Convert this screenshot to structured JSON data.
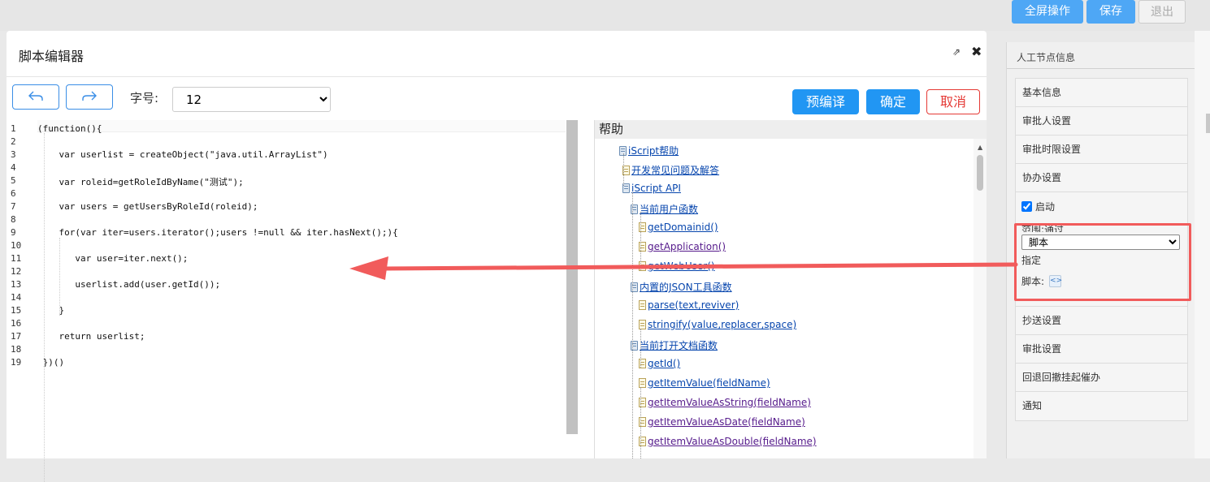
{
  "top_toolbar": {
    "fullscreen_label": "全屏操作",
    "save_label": "保存",
    "exit_label": "退出"
  },
  "right_panel": {
    "title": "人工节点信息",
    "items_top": [
      "基本信息",
      "审批人设置",
      "审批时限设置",
      "协办设置"
    ],
    "enable_label": "启动",
    "partial_label": "范围:通过",
    "selected_option": "脚本",
    "assign_label": "指定",
    "script_label": "脚本:",
    "items_bottom": [
      "抄送设置",
      "审批设置",
      "回退回撤挂起催办",
      "通知"
    ]
  },
  "modal": {
    "title": "脚本编辑器",
    "font_size_label": "字号:",
    "font_size_value": "12",
    "precompile_label": "预编译",
    "confirm_label": "确定",
    "cancel_label": "取消"
  },
  "editor": {
    "line_numbers": [
      "1",
      "2",
      "3",
      "4",
      "5",
      "6",
      "7",
      "8",
      "9",
      "10",
      "11",
      "12",
      "13",
      "14",
      "15",
      "16",
      "17",
      "18",
      "19"
    ],
    "lines": [
      "(function(){",
      "",
      "    var userlist = createObject(\"java.util.ArrayList\")",
      "",
      "    var roleid=getRoleIdByName(\"测试\");",
      "",
      "    var users = getUsersByRoleId(roleid);",
      "",
      "    for(var iter=users.iterator();users !=null && iter.hasNext();){",
      "",
      "       var user=iter.next();",
      "",
      "       userlist.add(user.getId());",
      "",
      "    }",
      "",
      "    return userlist;",
      "",
      " })()"
    ]
  },
  "help": {
    "title": "帮助",
    "items": [
      {
        "text": "iScript帮助",
        "icon": "book-icon"
      },
      {
        "text": "开发常见问题及解答",
        "icon": "doc-icon"
      },
      {
        "text": "iScript API",
        "icon": "book-icon"
      },
      {
        "text": "当前用户函数",
        "icon": "book-icon"
      },
      {
        "text": "getDomainid()",
        "icon": "doc-icon"
      },
      {
        "text": "getApplication()",
        "icon": "doc-icon"
      },
      {
        "text": "getWebUser()",
        "icon": "doc-icon"
      },
      {
        "text": "内置的JSON工具函数",
        "icon": "book-icon"
      },
      {
        "text": "parse(text,reviver)",
        "icon": "doc-icon"
      },
      {
        "text": "stringify(value,replacer,space)",
        "icon": "doc-icon"
      },
      {
        "text": "当前打开文档函数",
        "icon": "book-icon"
      },
      {
        "text": "getId()",
        "icon": "doc-icon"
      },
      {
        "text": "getItemValue(fieldName)",
        "icon": "doc-icon"
      },
      {
        "text": "getItemValueAsString(fieldName)",
        "icon": "doc-icon"
      },
      {
        "text": "getItemValueAsDate(fieldName)",
        "icon": "doc-icon"
      },
      {
        "text": "getItemValueAsDouble(fieldName)",
        "icon": "doc-icon"
      }
    ]
  },
  "colors": {
    "primary": "#2196f3",
    "danger": "#e53935",
    "annotation": "#f15b5b"
  }
}
